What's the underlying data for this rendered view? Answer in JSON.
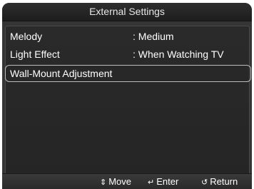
{
  "osd": {
    "title": "External Settings",
    "items": [
      {
        "label": "Melody",
        "value": ": Medium",
        "selected": false
      },
      {
        "label": "Light Effect",
        "value": ": When Watching TV",
        "selected": false
      },
      {
        "label": "Wall-Mount Adjustment",
        "value": "",
        "selected": true
      }
    ]
  },
  "footer": {
    "move_label": "Move",
    "enter_label": "Enter",
    "return_label": "Return",
    "move_icon": "updown-arrows-icon",
    "enter_icon": "enter-icon",
    "return_icon": "return-icon"
  }
}
